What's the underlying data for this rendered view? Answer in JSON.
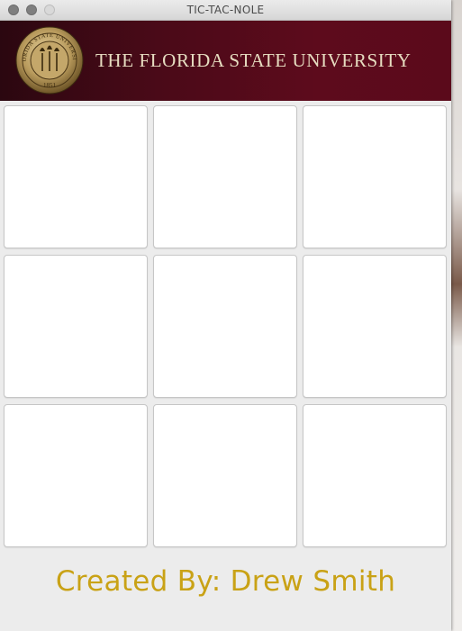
{
  "window": {
    "title": "TIC-TAC-NOLE"
  },
  "banner": {
    "university": "THE FLORIDA STATE UNIVERSITY",
    "seal_text": "FLORIDA STATE UNIVERSITY",
    "seal_year": "1851",
    "colors": {
      "garnet": "#5d0b1c",
      "gold": "#c9a216"
    }
  },
  "board": {
    "cells": [
      [
        "",
        "",
        ""
      ],
      [
        "",
        "",
        ""
      ],
      [
        "",
        "",
        ""
      ]
    ]
  },
  "footer": {
    "credit": "Created By: Drew Smith"
  }
}
